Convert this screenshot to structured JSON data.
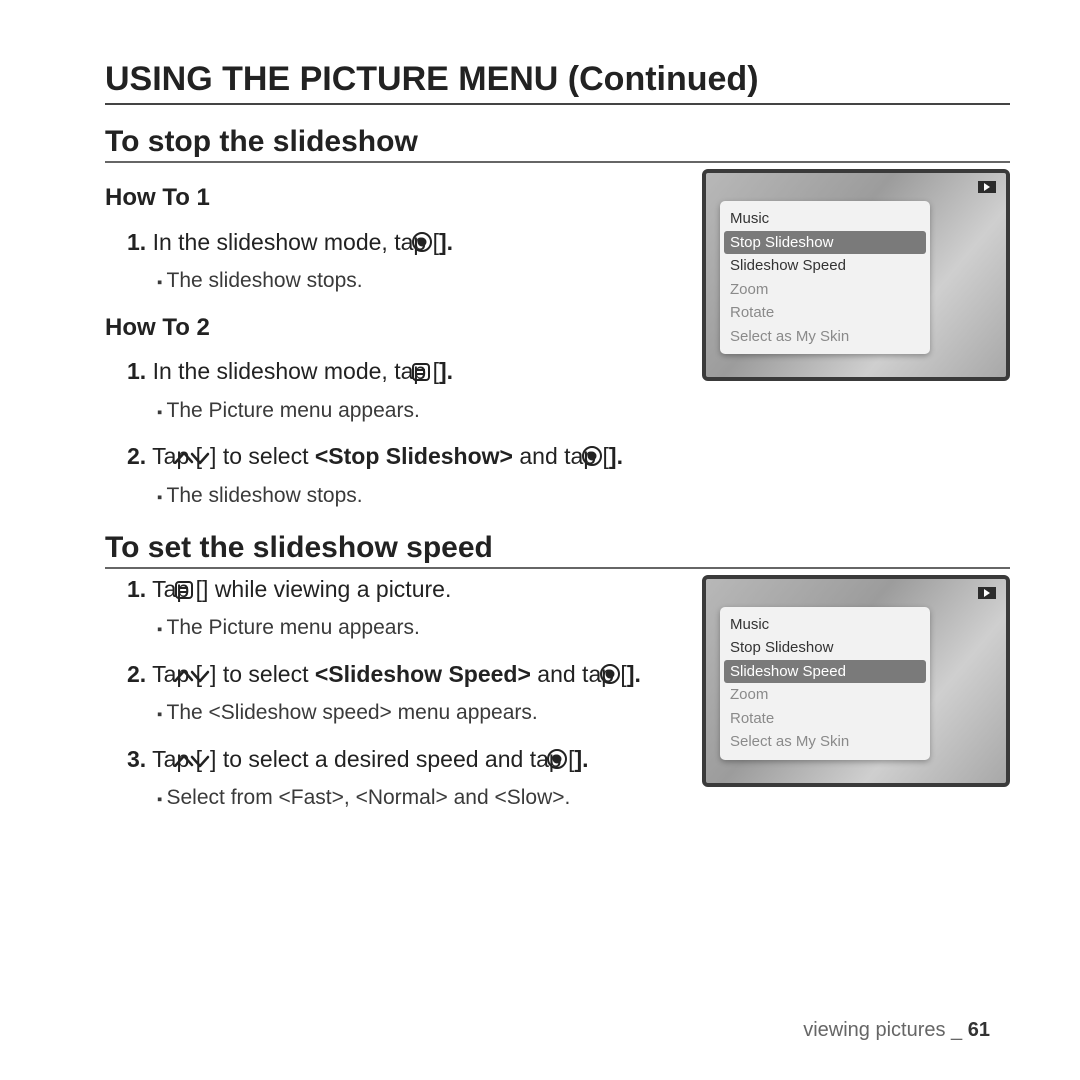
{
  "title": "USING THE PICTURE MENU (Continued)",
  "section1": {
    "heading": "To stop the slideshow",
    "howto1_label": "How To 1",
    "howto1_step1_a": "1.",
    "howto1_step1_b": "In the slideshow mode, tap [",
    "howto1_step1_c": "].",
    "howto1_sub": "The slideshow stops.",
    "howto2_label": "How To 2",
    "howto2_step1_a": "1.",
    "howto2_step1_b": "In the slideshow mode, tap [",
    "howto2_step1_c": "].",
    "howto2_sub1": "The Picture menu appears.",
    "howto2_step2_a": "2.",
    "howto2_step2_b": "Tap [",
    "howto2_step2_c": "] to select ",
    "howto2_step2_d": "<Stop Slideshow>",
    "howto2_step2_e": " and tap [",
    "howto2_step2_f": "].",
    "howto2_sub2": "The slideshow stops."
  },
  "section2": {
    "heading": "To set the slideshow speed",
    "step1_a": "1.",
    "step1_b": "Tap [",
    "step1_c": "] while viewing a picture.",
    "sub1": "The Picture menu appears.",
    "step2_a": "2.",
    "step2_b": "Tap [",
    "step2_c": "] to select ",
    "step2_d": "<Slideshow Speed>",
    "step2_e": " and tap [",
    "step2_f": "].",
    "sub2": "The <Slideshow speed> menu appears.",
    "step3_a": "3.",
    "step3_b": "Tap [",
    "step3_c": "] to select a desired speed and tap [",
    "step3_d": "].",
    "sub3": "Select from <Fast>, <Normal> and <Slow>."
  },
  "menu": {
    "items": [
      "Music",
      "Stop Slideshow",
      "Slideshow Speed",
      "Zoom",
      "Rotate",
      "Select as My Skin"
    ]
  },
  "footer": {
    "label": "viewing pictures _ ",
    "page": "61"
  }
}
